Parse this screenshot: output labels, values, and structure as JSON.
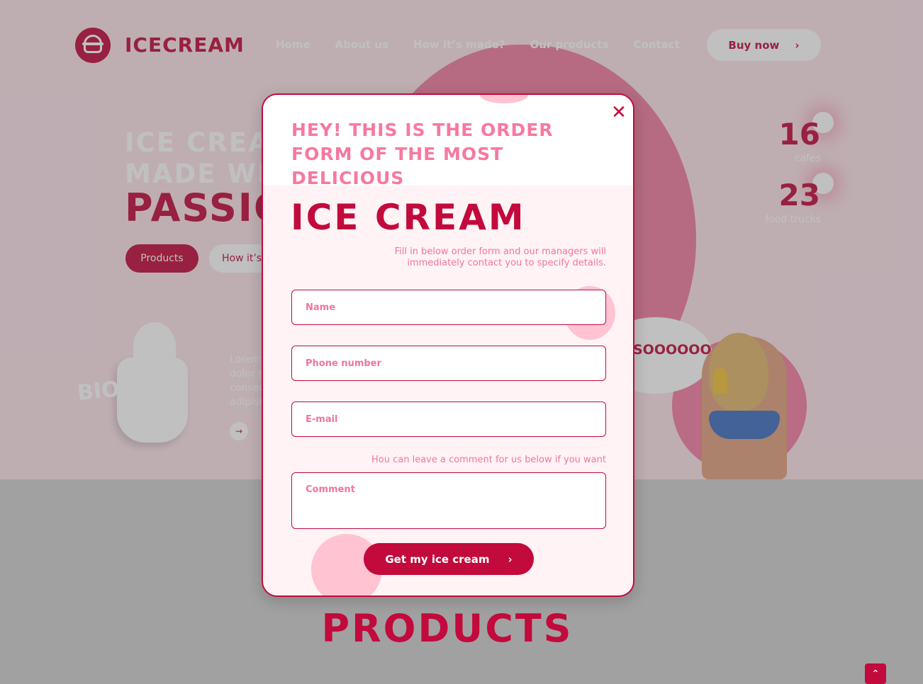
{
  "brand": "ICECREAM",
  "nav": [
    "Home",
    "About us",
    "How it’s made?",
    "Our products",
    "Contact"
  ],
  "buy_button": {
    "label": "Buy now",
    "icon": "chevron-right-icon"
  },
  "hero": {
    "line1": "ICE CREAM",
    "line2": "MADE WITH",
    "line3": "PASSION",
    "products_button": "Products",
    "howto_button": "How it’s made"
  },
  "stats": [
    {
      "value": "16",
      "label": "cafes"
    },
    {
      "value": "23",
      "label": "food trucks"
    }
  ],
  "bio": {
    "text": "BIO ECO"
  },
  "lorem": "Lorem ipsum dolor sit amet, consectetur adipiscing elit, sed do eiusmod tempor incididunt",
  "bubble": {
    "text": "SOOOOOO TASTY!"
  },
  "products_heading": "PRODUCTS",
  "modal": {
    "heading": "HEY! THIS IS THE ORDER FORM OF THE MOST DELICIOUS",
    "title": "ICE CREAM",
    "description": "Fill in below order form and our managers will immediately contact you to specify details.",
    "fields": {
      "name_placeholder": "Name",
      "phone_placeholder": "Phone number",
      "email_placeholder": "E-mail"
    },
    "comment_note": "Hou can leave a comment for us below if you want",
    "comment_placeholder": "Comment",
    "submit": {
      "label": "Get my ice cream",
      "icon": "chevron-right-icon"
    },
    "close_icon": "close-icon"
  },
  "colors": {
    "brand": "#c20a3c",
    "pink": "#f0769b",
    "hero_bg": "#fce3ea"
  }
}
